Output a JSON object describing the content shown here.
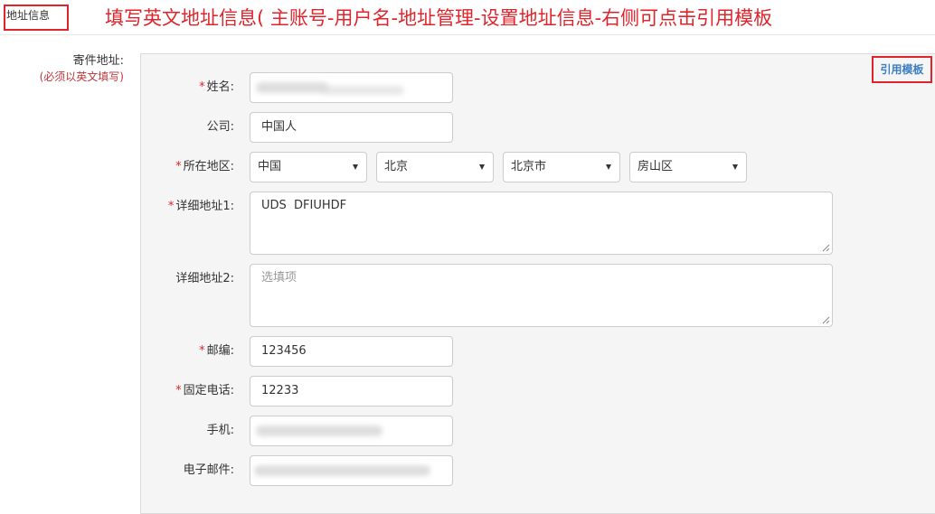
{
  "header": {
    "section_label": "地址信息",
    "instruction": "填写英文地址信息( 主账号-用户名-地址管理-设置地址信息-右侧可点击引用模板"
  },
  "sender": {
    "label": "寄件地址:",
    "note": "(必须以英文填写)"
  },
  "template_link": "引用模板",
  "form": {
    "required_mark": "*",
    "name": {
      "label": "姓名:",
      "value": ""
    },
    "company": {
      "label": "公司:",
      "value": "中国人"
    },
    "region": {
      "label": "所在地区:",
      "country": "中国",
      "province": "北京",
      "city": "北京市",
      "district": "房山区"
    },
    "address1": {
      "label": "详细地址1:",
      "value": "UDS  DFIUHDF"
    },
    "address2": {
      "label": "详细地址2:",
      "value": "",
      "placeholder": "选填项"
    },
    "postcode": {
      "label": "邮编:",
      "value": "123456"
    },
    "phone": {
      "label": "固定电话:",
      "value": "12233"
    },
    "mobile": {
      "label": "手机:",
      "value": ""
    },
    "email": {
      "label": "电子邮件:",
      "value": ""
    }
  }
}
